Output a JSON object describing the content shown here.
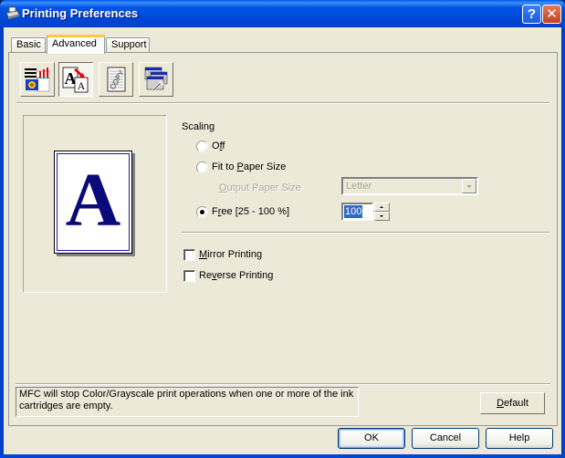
{
  "window": {
    "title": "Printing Preferences",
    "help_button": "?",
    "close_button": "✕"
  },
  "tabs": [
    {
      "label": "Basic",
      "active": false
    },
    {
      "label": "Advanced",
      "active": true
    },
    {
      "label": "Support",
      "active": false
    }
  ],
  "toolbar": {
    "buttons": [
      {
        "icon": "color-quality-icon",
        "pressed": false
      },
      {
        "icon": "scaling-icon",
        "pressed": true
      },
      {
        "icon": "watermark-copy-icon",
        "pressed": false
      },
      {
        "icon": "device-options-icon",
        "pressed": false
      }
    ]
  },
  "preview": {
    "letter": "A"
  },
  "scaling": {
    "group_label": "Scaling",
    "options": [
      {
        "pre": "O",
        "accel": "f",
        "post": "f",
        "selected": false
      },
      {
        "pre": "Fit to ",
        "accel": "P",
        "post": "aper Size",
        "selected": false
      },
      {
        "pre": "F",
        "accel": "r",
        "post": "ee [25 - 100 %]",
        "selected": true
      }
    ],
    "output_paper_size": {
      "label_accel": "O",
      "label_rest": "utput Paper Size",
      "value": "Letter",
      "enabled": false
    },
    "free_value": "100"
  },
  "checkboxes": [
    {
      "accel": "M",
      "rest": "irror Printing",
      "checked": false
    },
    {
      "pre": "Re",
      "accel": "v",
      "rest": "erse Printing",
      "checked": false
    }
  ],
  "status_message": "MFC will stop Color/Grayscale print operations when one or more of the ink cartridges are empty.",
  "buttons": {
    "default_accel": "D",
    "default_rest": "efault",
    "ok": "OK",
    "cancel": "Cancel",
    "help": "Help"
  }
}
